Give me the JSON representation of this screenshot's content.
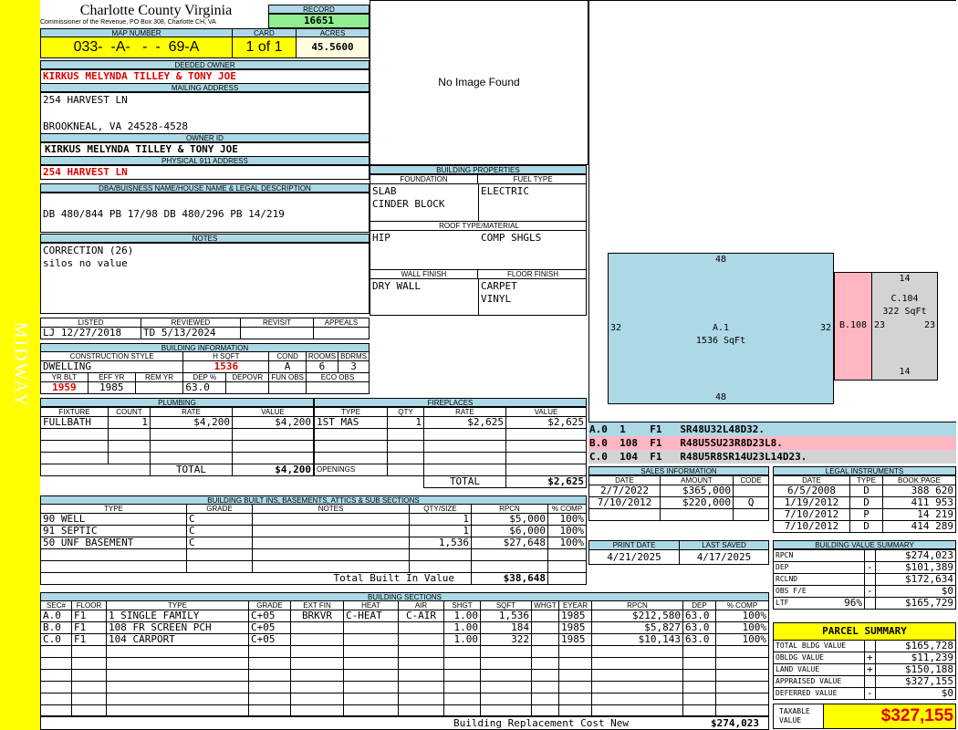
{
  "sidebar_label": "MIDWAY",
  "header": {
    "county": "Charlotte County Virginia",
    "commissioner": "Commissioner of the Revenue, PO Box 308, Charlotte CH, VA",
    "record_label": "RECORD",
    "record": "16651",
    "map_label": "MAP NUMBER",
    "card_label": "CARD",
    "acres_label": "ACRES",
    "map_number": "033-  -A-   -  -  69-A",
    "card": "1 of 1",
    "acres": "45.5600"
  },
  "owner": {
    "deeded_label": "DEEDED OWNER",
    "deeded": "KIRKUS MELYNDA TILLEY & TONY JOE",
    "mailing_label": "MAILING ADDRESS",
    "mail1": "254 HARVEST LN",
    "mail2": "BROOKNEAL, VA 24528-4528",
    "owner_id_label": "OWNER ID",
    "owner_id": "KIRKUS MELYNDA TILLEY & TONY JOE",
    "phys_label": "PHYSICAL 911 ADDRESS",
    "phys": "254 HARVEST LN"
  },
  "legal": {
    "label": "DBA/BUISNESS NAME/HOUSE NAME & LEGAL DESCRIPTION",
    "text": "DB 480/844 PB 17/98 DB 480/296 PB 14/219"
  },
  "notes": {
    "label": "NOTES",
    "line1": "CORRECTION (26)",
    "line2": "silos no value"
  },
  "image": {
    "text": "No Image Found"
  },
  "bprops": {
    "label": "BUILDING PROPERTIES",
    "foundation_label": "FOUNDATION",
    "fuel_label": "FUEL TYPE",
    "foundation1": "SLAB",
    "foundation2": "CINDER BLOCK",
    "fuel": "ELECTRIC",
    "roof_label": "ROOF TYPE/MATERIAL",
    "roof_type": "HIP",
    "roof_mat": "COMP SHGLS",
    "wall_label": "WALL FINISH",
    "floor_label": "FLOOR FINISH",
    "wall": "DRY WALL",
    "floor1": "CARPET",
    "floor2": "VINYL"
  },
  "listed": {
    "listed_label": "LISTED",
    "reviewed_label": "REVIEWED",
    "revisit_label": "REVISIT",
    "appeals_label": "APPEALS",
    "listed_by": "LJ",
    "listed_date": "12/27/2018",
    "reviewed_by": "TD",
    "reviewed_date": "5/13/2024"
  },
  "binfo": {
    "label": "BUILDING INFORMATION",
    "h": [
      "CONSTRUCTION STYLE",
      "H SQFT",
      "COND",
      "ROOMS",
      "BDRMS"
    ],
    "style": "DWELLING",
    "hsqft": "1536",
    "cond": "A",
    "rooms": "6",
    "bdrms": "3",
    "h2": [
      "YR BLT",
      "EFF YR",
      "REM YR",
      "DEP %",
      "DEPOVR",
      "FUN OBS",
      "ECO OBS"
    ],
    "yrblt": "1959",
    "effyr": "1985",
    "dep": "63.0"
  },
  "plumbing": {
    "label": "PLUMBING",
    "h": [
      "FIXTURE",
      "COUNT",
      "RATE",
      "VALUE"
    ],
    "fixture": "FULLBATH",
    "count": "1",
    "rate": "$4,200",
    "value": "$4,200",
    "total_label": "TOTAL",
    "total": "$4,200"
  },
  "fireplaces": {
    "label": "FIREPLACES",
    "h": [
      "TYPE",
      "QTY",
      "RATE",
      "VALUE"
    ],
    "type": "1ST MAS",
    "qty": "1",
    "rate": "$2,625",
    "value": "$2,625",
    "openings_label": "OPENINGS",
    "total_label": "TOTAL",
    "total": "$2,625"
  },
  "sketch": {
    "a_top": "48",
    "a_bottom": "48",
    "a_left": "32",
    "a_right": "32",
    "a_label": "A.1",
    "a_area": "1536 SqFt",
    "b_label": "B.108",
    "c_top": "14",
    "c_bottom": "14",
    "c_left": "23",
    "c_right": "23",
    "c_label": "C.104",
    "c_area": "322 SqFt",
    "colors": {
      "a": "#add8e6",
      "b": "#ffb6c1",
      "c": "#d3d3d3"
    }
  },
  "traverse": [
    {
      "text": "A.0  1    F1   SR48U32L48D32.",
      "color": "#add8e6"
    },
    {
      "text": "B.0  108  F1   R48U5SU23R8D23L8.",
      "color": "#ffb6c1"
    },
    {
      "text": "C.0  104  F1   R48U5R8SR14U23L14D23.",
      "color": "#d3d3d3"
    }
  ],
  "builtins": {
    "label": "BUILDING BUILT INS, BASEMENTS, ATTICS & SUB SECTIONS",
    "h": [
      "TYPE",
      "GRADE",
      "NOTES",
      "QTY/SIZE",
      "RPCN",
      "% COMP"
    ],
    "rows": [
      {
        "type": "90 WELL",
        "grade": "C",
        "qty": "1",
        "rpcn": "$5,000",
        "comp": "100%"
      },
      {
        "type": "91 SEPTIC",
        "grade": "C",
        "qty": "1",
        "rpcn": "$6,000",
        "comp": "100%"
      },
      {
        "type": "50 UNF BASEMENT",
        "grade": "C",
        "qty": "1,536",
        "rpcn": "$27,648",
        "comp": "100%"
      }
    ],
    "total_label": "Total Built In Value",
    "total": "$38,648"
  },
  "sales": {
    "label": "SALES INFORMATION",
    "h": [
      "DATE",
      "AMOUNT",
      "CODE"
    ],
    "rows": [
      {
        "date": "2/7/2022",
        "amount": "$365,000",
        "code": ""
      },
      {
        "date": "7/10/2012",
        "amount": "$220,000",
        "code": "Q"
      }
    ]
  },
  "legalinst": {
    "label": "LEGAL INSTRUMENTS",
    "h": [
      "DATE",
      "TYPE",
      "BOOK:PAGE"
    ],
    "rows": [
      {
        "date": "6/5/2008",
        "type": "D",
        "bp": "388 620"
      },
      {
        "date": "1/19/2012",
        "type": "D",
        "bp": "411 953"
      },
      {
        "date": "7/10/2012",
        "type": "P",
        "bp": "14 219"
      },
      {
        "date": "7/10/2012",
        "type": "D",
        "bp": "414 289"
      }
    ]
  },
  "print": {
    "print_label": "PRINT DATE",
    "saved_label": "LAST SAVED",
    "print_date": "4/21/2025",
    "saved_date": "4/17/2025"
  },
  "bvs": {
    "label": "BUILDING VALUE SUMMARY",
    "rows": [
      {
        "k": "RPCN",
        "s": "",
        "v": "$274,023"
      },
      {
        "k": "DEP",
        "s": "-",
        "v": "$101,389"
      },
      {
        "k": "RCLND",
        "s": "",
        "v": "$172,634"
      },
      {
        "k": "OBS F/E",
        "s": "-",
        "v": "$0"
      },
      {
        "k": "LTF",
        "p": "96%",
        "s": "",
        "v": "$165,729"
      }
    ]
  },
  "parcel": {
    "label": "PARCEL SUMMARY",
    "rows": [
      {
        "k": "TOTAL BLDG VALUE",
        "s": "",
        "v": "$165,728"
      },
      {
        "k": "OBLDG VALUE",
        "s": "+",
        "v": "$11,239"
      },
      {
        "k": "LAND VALUE",
        "s": "+",
        "v": "$150,188"
      },
      {
        "k": "APPRAISED VALUE",
        "s": "",
        "v": "$327,155"
      },
      {
        "k": "DEFERRED VALUE",
        "s": "-",
        "v": "$0"
      }
    ],
    "taxable_label1": "TAXABLE",
    "taxable_label2": "VALUE",
    "taxable": "$327,155"
  },
  "sections": {
    "label": "BUILDING SECTIONS",
    "h": [
      "SEC#",
      "FLOOR",
      "TYPE",
      "GRADE",
      "EXT FIN",
      "HEAT",
      "AIR",
      "SHGT",
      "SQFT",
      "WHGT",
      "EYEAR",
      "RPCN",
      "DEP",
      "% COMP"
    ],
    "rows": [
      {
        "sec": "A.0",
        "floor": "F1",
        "type": "1 SINGLE FAMILY",
        "grade": "C+05",
        "ext": "BRKVR",
        "heat": "C-HEAT",
        "air": "C-AIR",
        "shgt": "1.00",
        "sqft": "1,536",
        "whgt": "",
        "eyear": "1985",
        "rpcn": "$212,580",
        "dep": "63.0",
        "comp": "100%"
      },
      {
        "sec": "B.0",
        "floor": "F1",
        "type": "108 FR SCREEN PCH",
        "grade": "C+05",
        "ext": "",
        "heat": "",
        "air": "",
        "shgt": "1.00",
        "sqft": "184",
        "whgt": "",
        "eyear": "1985",
        "rpcn": "$5,827",
        "dep": "63.0",
        "comp": "100%"
      },
      {
        "sec": "C.0",
        "floor": "F1",
        "type": "104 CARPORT",
        "grade": "C+05",
        "ext": "",
        "heat": "",
        "air": "",
        "shgt": "1.00",
        "sqft": "322",
        "whgt": "",
        "eyear": "1985",
        "rpcn": "$10,143",
        "dep": "63.0",
        "comp": "100%"
      }
    ],
    "total_label": "Building Replacement Cost New",
    "total": "$274,023"
  }
}
